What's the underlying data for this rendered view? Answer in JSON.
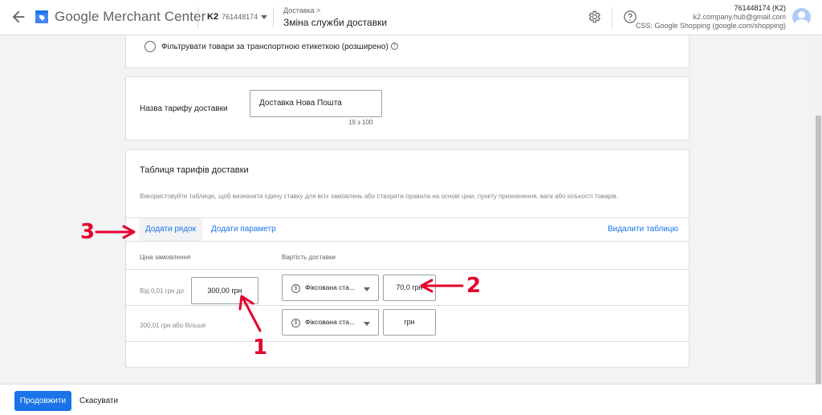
{
  "header": {
    "brand": "Google Merchant Center",
    "account_name": "K2",
    "account_id": "761448174",
    "breadcrumb": "Доставка >",
    "page_title": "Зміна служби доставки",
    "user_line1": "761448174 (K2)",
    "user_line2": "k2.company.hub@gmail.com",
    "user_line3": "CSS: Google Shopping (google.com/shopping)",
    "icons": [
      "arrow-left-icon",
      "merchant-logo-icon",
      "gear-icon",
      "help-icon",
      "avatar-icon"
    ]
  },
  "filter_option": {
    "label": "Фільтрувати товари за транспортною етикеткою (розширено)",
    "help_glyph": "?"
  },
  "rate_name": {
    "label": "Назва тарифу доставки",
    "value": "Доставка Нова Пошта",
    "counter": "19 з 100"
  },
  "rate_table": {
    "title": "Таблиця тарифів доставки",
    "description": "Використовуйте таблицю, щоб визначити єдину ставку для всіх замовлень або створити правила на основі ціни, пункту призначення, ваги або кількості товарів.",
    "add_row": "Додати рядок",
    "add_param": "Додати параметр",
    "delete_table": "Видалити таблицю",
    "col_order_price": "Ціна замовлення",
    "col_shipping_cost": "Вартість доставки",
    "rows": [
      {
        "condition": "Від 0,01 грн до",
        "price": "300,00 грн",
        "type": "Фіксована ста...",
        "cost": "70,0 грн"
      },
      {
        "condition": "300,01 грн або більше",
        "type": "Фіксована ста...",
        "cost": "грн"
      }
    ],
    "currency_glyph": "$"
  },
  "footer": {
    "continue": "Продовжити",
    "cancel": "Скасувати"
  },
  "annotations": {
    "n1": "1",
    "n2": "2",
    "n3": "3",
    "color": "#e6002e"
  }
}
